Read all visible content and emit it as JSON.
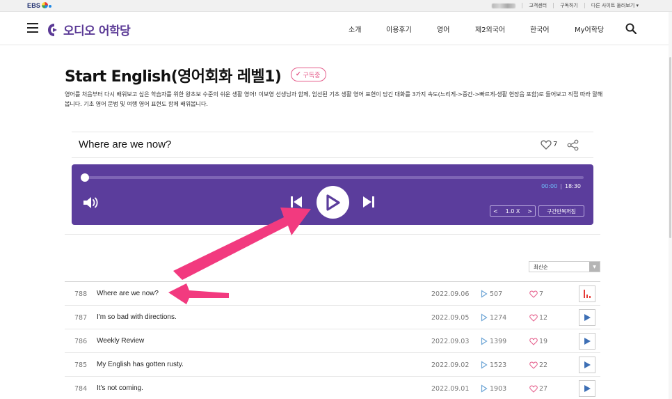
{
  "utility_bar": {
    "brand": "EBS",
    "links": [
      "고객센터",
      "구독하기",
      "다른 사이트 둘러보기 ▾"
    ]
  },
  "nav": {
    "logo_text": "오디오 어학당",
    "menu": [
      "소개",
      "이용후기",
      "영어",
      "제2외국어",
      "한국어",
      "My어학당"
    ]
  },
  "course": {
    "title": "Start English(영어회화 레벨1)",
    "subscribe_badge": "구독중",
    "description": "영어를 처음부터 다시 배워보고 싶은 학습자를 위한 왕초보 수준의 쉬운 생활 영어! 이보영 선생님과 함께, 엄선된 기초 생활 영어 표현이 담긴 대화를 3가지 속도(느리게->중간->빠르게-생활 현장음 포함)로 들어보고 직접 따라 말해봅니다. 기초 영어 문법 및 여행 영어 표현도 함께 배워봅니다."
  },
  "episode": {
    "title": "Where are we now?",
    "likes": "7"
  },
  "player": {
    "current_time": "00:00",
    "total_time": "18:30",
    "progress": 0.0,
    "speed": "1.0 X",
    "speed_prev": "<",
    "speed_next": ">",
    "repeat_label": "구간반복꺼짐",
    "colors": {
      "background": "#5b3d9c",
      "accent": "#6fc3ff"
    }
  },
  "sort": {
    "selected": "최신순"
  },
  "episodes": [
    {
      "num": "788",
      "title": "Where are we now?",
      "date": "2022.09.06",
      "plays": "507",
      "likes": "7",
      "playing": true
    },
    {
      "num": "787",
      "title": "I'm so bad with directions.",
      "date": "2022.09.05",
      "plays": "1274",
      "likes": "12",
      "playing": false
    },
    {
      "num": "786",
      "title": "Weekly Review",
      "date": "2022.09.03",
      "plays": "1399",
      "likes": "19",
      "playing": false
    },
    {
      "num": "785",
      "title": "My English has gotten rusty.",
      "date": "2022.09.02",
      "plays": "1523",
      "likes": "22",
      "playing": false
    },
    {
      "num": "784",
      "title": "It's not coming.",
      "date": "2022.09.01",
      "plays": "1903",
      "likes": "27",
      "playing": false
    }
  ],
  "annotation_color": "#f23a7f"
}
